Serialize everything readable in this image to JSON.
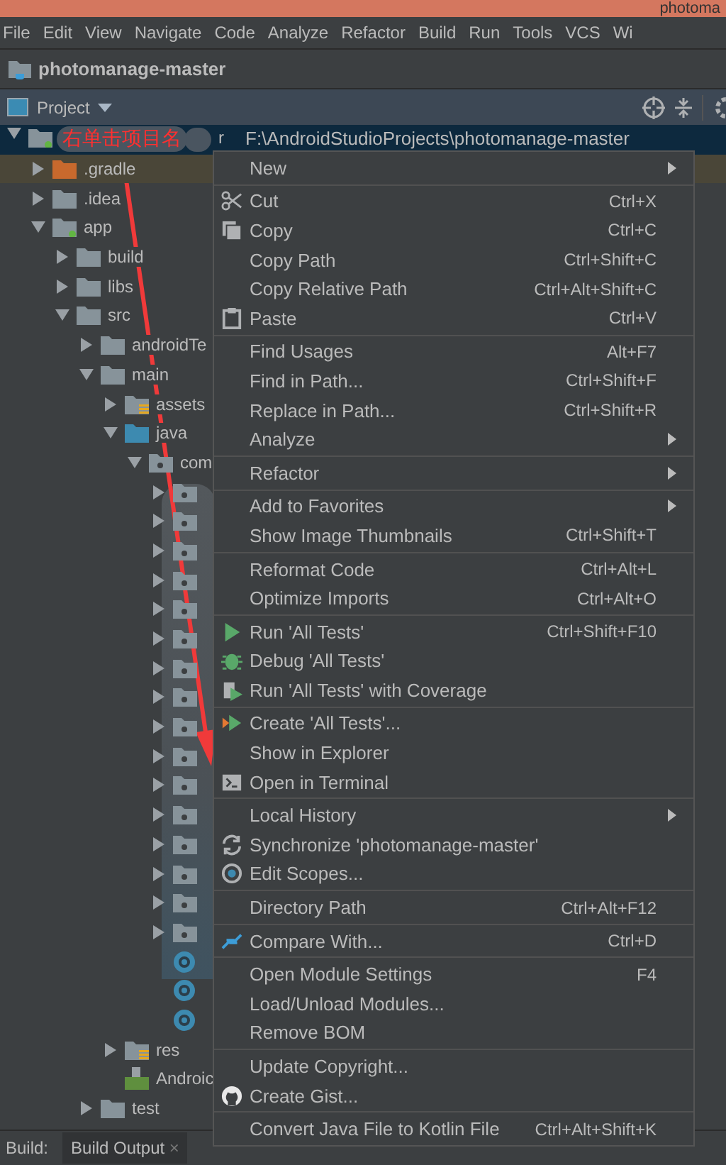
{
  "window": {
    "title": "photoma"
  },
  "menu_bar": [
    "File",
    "Edit",
    "View",
    "Navigate",
    "Code",
    "Analyze",
    "Refactor",
    "Build",
    "Run",
    "Tools",
    "VCS",
    "Wi"
  ],
  "navigation": {
    "project": "photomanage-master"
  },
  "project_panel": {
    "title": "Project",
    "tree": [
      {
        "label": "r",
        "path": "F:\\AndroidStudioProjects\\photomanage-master",
        "kind": "module",
        "expanded": true,
        "selected": true,
        "children": [
          {
            "label": ".gradle",
            "kind": "excluded",
            "expanded": false,
            "selected": false
          },
          {
            "label": ".idea",
            "kind": "folder",
            "expanded": false,
            "selected": false
          },
          {
            "label": "app",
            "kind": "module",
            "expanded": true,
            "selected": false,
            "children": [
              {
                "label": "build",
                "kind": "folder",
                "expanded": false,
                "selected": false
              },
              {
                "label": "libs",
                "kind": "folder",
                "expanded": false,
                "selected": false
              },
              {
                "label": "src",
                "kind": "folder",
                "expanded": true,
                "selected": false,
                "children": [
                  {
                    "label": "androidTe",
                    "kind": "folder",
                    "expanded": false,
                    "selected": false
                  },
                  {
                    "label": "main",
                    "kind": "folder",
                    "expanded": true,
                    "selected": false,
                    "children": [
                      {
                        "label": "assets",
                        "kind": "resource",
                        "expanded": false,
                        "selected": false
                      },
                      {
                        "label": "java",
                        "kind": "source",
                        "expanded": true,
                        "selected": false,
                        "children": [
                          {
                            "label": "com",
                            "kind": "package",
                            "expanded": true,
                            "selected": false,
                            "children": [
                              {
                                "kind": "package",
                                "expanded": false,
                                "selected": false
                              },
                              {
                                "kind": "package",
                                "expanded": false,
                                "selected": false
                              },
                              {
                                "kind": "package",
                                "expanded": false,
                                "selected": false
                              },
                              {
                                "kind": "package",
                                "expanded": false,
                                "selected": false
                              },
                              {
                                "kind": "package",
                                "expanded": false,
                                "selected": false
                              },
                              {
                                "kind": "package",
                                "expanded": false,
                                "selected": false
                              },
                              {
                                "kind": "package",
                                "expanded": false,
                                "selected": false
                              },
                              {
                                "kind": "package",
                                "expanded": false,
                                "selected": false
                              },
                              {
                                "kind": "package",
                                "expanded": false,
                                "selected": false
                              },
                              {
                                "kind": "package",
                                "expanded": false,
                                "selected": false
                              },
                              {
                                "kind": "package",
                                "expanded": false,
                                "selected": false
                              },
                              {
                                "kind": "package",
                                "expanded": false,
                                "selected": false
                              },
                              {
                                "kind": "package",
                                "expanded": false,
                                "selected": false
                              },
                              {
                                "kind": "package",
                                "expanded": false,
                                "selected": false
                              },
                              {
                                "kind": "package",
                                "expanded": false,
                                "selected": false
                              },
                              {
                                "kind": "package",
                                "expanded": false,
                                "selected": false
                              },
                              {
                                "kind": "class",
                                "selected": false
                              },
                              {
                                "kind": "class",
                                "selected": false
                              },
                              {
                                "kind": "class",
                                "selected": false
                              }
                            ]
                          }
                        ]
                      },
                      {
                        "label": "res",
                        "kind": "resource",
                        "expanded": false,
                        "selected": false
                      },
                      {
                        "label": "Androic",
                        "kind": "manifest",
                        "selected": false
                      }
                    ]
                  },
                  {
                    "label": "test",
                    "kind": "folder",
                    "expanded": false,
                    "selected": false
                  }
                ]
              }
            ]
          }
        ]
      }
    ]
  },
  "annotation": {
    "text": "右单击项目名"
  },
  "context_menu": [
    [
      {
        "label": "New",
        "submenu": true
      }
    ],
    [
      {
        "label": "Cut",
        "shortcut": "Ctrl+X",
        "submenu": false
      },
      {
        "label": "Copy",
        "shortcut": "Ctrl+C",
        "submenu": false
      },
      {
        "label": "Copy Path",
        "shortcut": "Ctrl+Shift+C",
        "submenu": false
      },
      {
        "label": "Copy Relative Path",
        "shortcut": "Ctrl+Alt+Shift+C",
        "submenu": false
      },
      {
        "label": "Paste",
        "shortcut": "Ctrl+V",
        "submenu": false
      }
    ],
    [
      {
        "label": "Find Usages",
        "shortcut": "Alt+F7",
        "submenu": false
      },
      {
        "label": "Find in Path...",
        "shortcut": "Ctrl+Shift+F",
        "submenu": false
      },
      {
        "label": "Replace in Path...",
        "shortcut": "Ctrl+Shift+R",
        "submenu": false
      },
      {
        "label": "Analyze",
        "submenu": true
      }
    ],
    [
      {
        "label": "Refactor",
        "submenu": true
      }
    ],
    [
      {
        "label": "Add to Favorites",
        "submenu": true
      },
      {
        "label": "Show Image Thumbnails",
        "shortcut": "Ctrl+Shift+T",
        "submenu": false
      }
    ],
    [
      {
        "label": "Reformat Code",
        "shortcut": "Ctrl+Alt+L",
        "submenu": false
      },
      {
        "label": "Optimize Imports",
        "shortcut": "Ctrl+Alt+O",
        "submenu": false
      }
    ],
    [
      {
        "label": "Run 'All Tests'",
        "shortcut": "Ctrl+Shift+F10",
        "submenu": false
      },
      {
        "label": "Debug 'All Tests'",
        "submenu": false
      },
      {
        "label": "Run 'All Tests' with Coverage",
        "submenu": false
      }
    ],
    [
      {
        "label": "Create 'All Tests'...",
        "submenu": false
      },
      {
        "label": "Show in Explorer",
        "submenu": false
      },
      {
        "label": "Open in Terminal",
        "submenu": false
      }
    ],
    [
      {
        "label": "Local History",
        "submenu": true
      },
      {
        "label": "Synchronize 'photomanage-master'",
        "submenu": false
      },
      {
        "label": "Edit Scopes...",
        "submenu": false
      }
    ],
    [
      {
        "label": "Directory Path",
        "shortcut": "Ctrl+Alt+F12",
        "submenu": false
      }
    ],
    [
      {
        "label": "Compare With...",
        "shortcut": "Ctrl+D",
        "submenu": false
      }
    ],
    [
      {
        "label": "Open Module Settings",
        "shortcut": "F4",
        "submenu": false
      },
      {
        "label": "Load/Unload Modules...",
        "submenu": false
      },
      {
        "label": "Remove BOM",
        "submenu": false
      }
    ],
    [
      {
        "label": "Update Copyright...",
        "submenu": false
      },
      {
        "label": "Create Gist...",
        "submenu": false
      }
    ],
    [
      {
        "label": "Convert Java File to Kotlin File",
        "shortcut": "Ctrl+Alt+Shift+K",
        "submenu": false
      }
    ]
  ],
  "bottom_bar": {
    "label": "Build:",
    "tabs": [
      {
        "label": "Build Output",
        "close": "×",
        "selected": true
      }
    ]
  }
}
